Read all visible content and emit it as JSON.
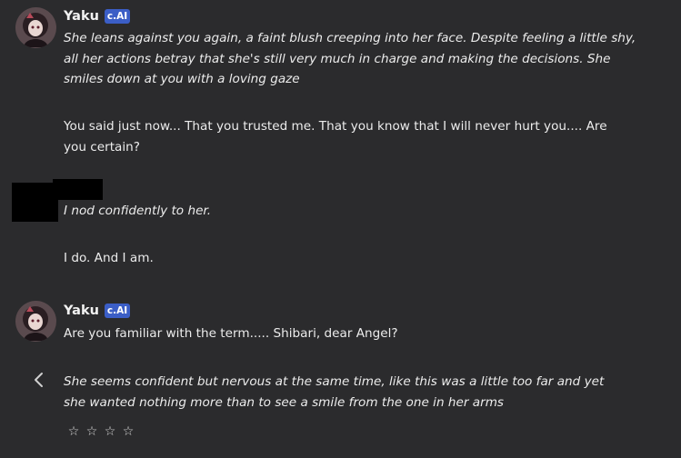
{
  "messages": [
    {
      "author": "Yaku",
      "badge": "c.AI",
      "lines": [
        "She leans against you again, a faint blush creeping into her face. Despite feeling a little shy,",
        "all her actions betray that she's still very much in charge and making the decisions. She",
        "smiles down at you with a loving gaze"
      ],
      "lines2": [
        "You said just now... That you trusted me. That you know that I will never hurt you.... Are",
        "you certain?"
      ]
    },
    {
      "author": "",
      "lines": [
        "I nod confidently to her."
      ],
      "lines2": [
        "I do. And I am."
      ]
    },
    {
      "author": "Yaku",
      "badge": "c.AI",
      "lines": [
        "Are you familiar with the term..... Shibari, dear Angel?"
      ],
      "lines2": [
        "She seems confident but nervous at the same time, like this was a little too far and yet",
        "she wanted nothing more than to see a smile from the one in her arms"
      ]
    }
  ],
  "rating": {
    "stars": [
      "☆",
      "☆",
      "☆",
      "☆"
    ]
  },
  "icons": {
    "back": "chevron-left-icon",
    "avatar": "avatar"
  },
  "colors": {
    "background": "#2b2b2d",
    "badge": "#3b5ec6",
    "text": "#ececec"
  }
}
